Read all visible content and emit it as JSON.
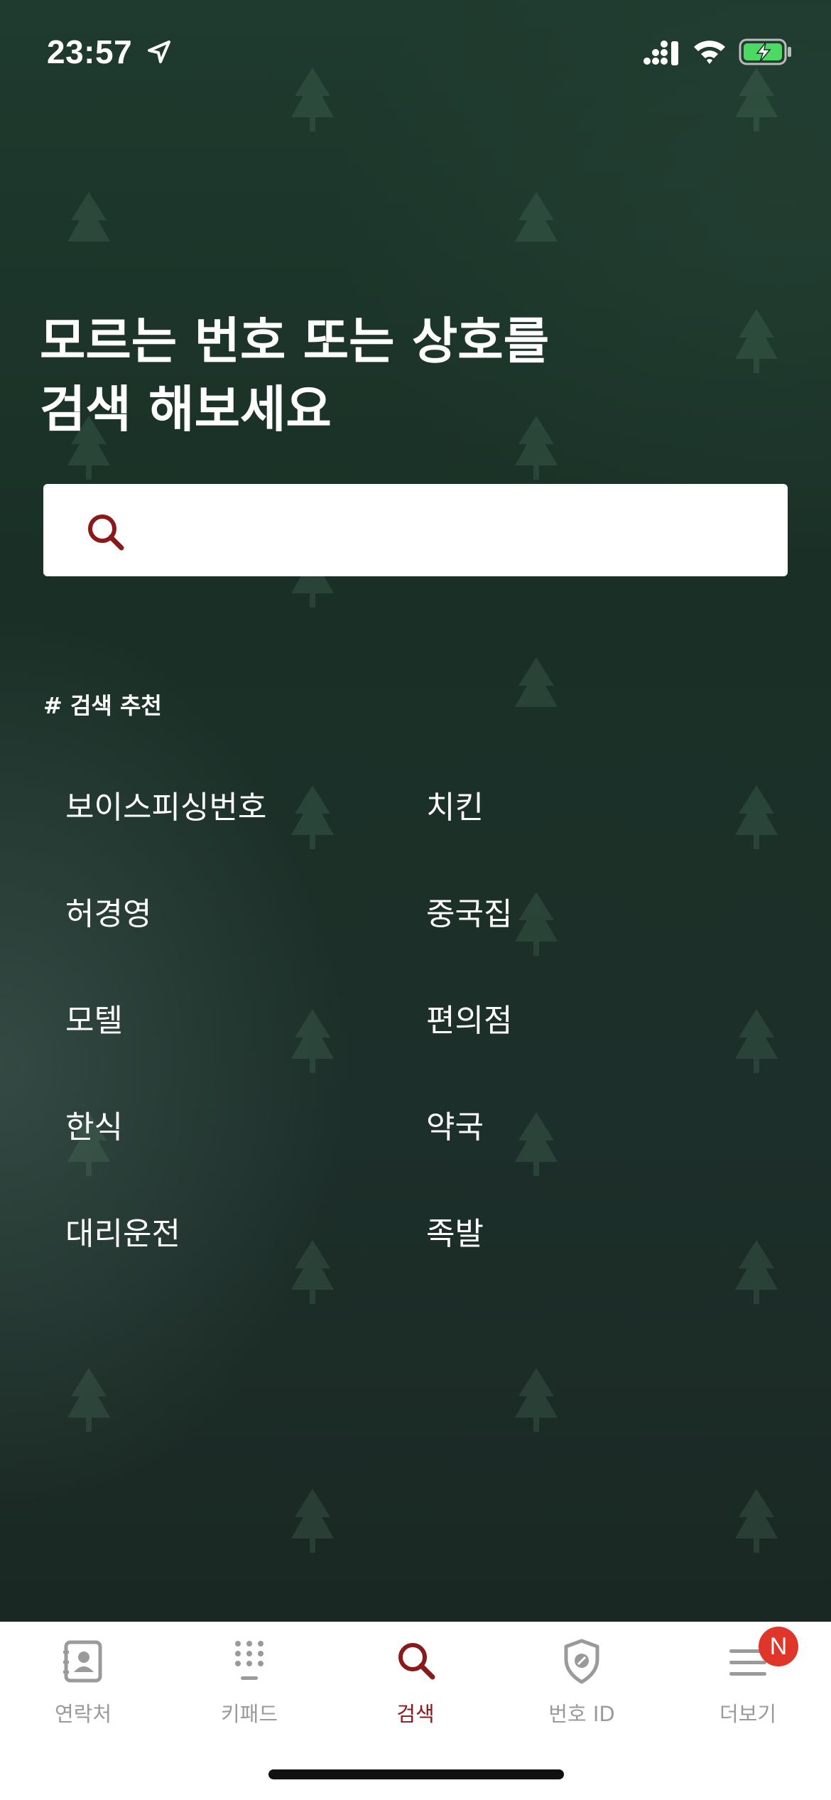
{
  "status_bar": {
    "time": "23:57"
  },
  "headline": {
    "line1": "모르는 번호 또는 상호를",
    "line2": "검색 해보세요"
  },
  "search": {
    "placeholder": "",
    "value": ""
  },
  "recommend": {
    "title": "# 검색 추천",
    "items": [
      "보이스피싱번호",
      "치킨",
      "허경영",
      "중국집",
      "모텔",
      "편의점",
      "한식",
      "약국",
      "대리운전",
      "족발"
    ]
  },
  "tabs": [
    {
      "label": "연락처",
      "icon": "contacts-icon"
    },
    {
      "label": "키패드",
      "icon": "keypad-icon"
    },
    {
      "label": "검색",
      "icon": "search-icon",
      "active": true
    },
    {
      "label": "번호 ID",
      "icon": "shield-icon"
    },
    {
      "label": "더보기",
      "icon": "menu-icon"
    }
  ],
  "more_badge": "N",
  "colors": {
    "accent": "#8a1a1a",
    "background": "#1c2e27",
    "badge": "#e0352b",
    "tab_inactive": "#9a9a9a"
  }
}
